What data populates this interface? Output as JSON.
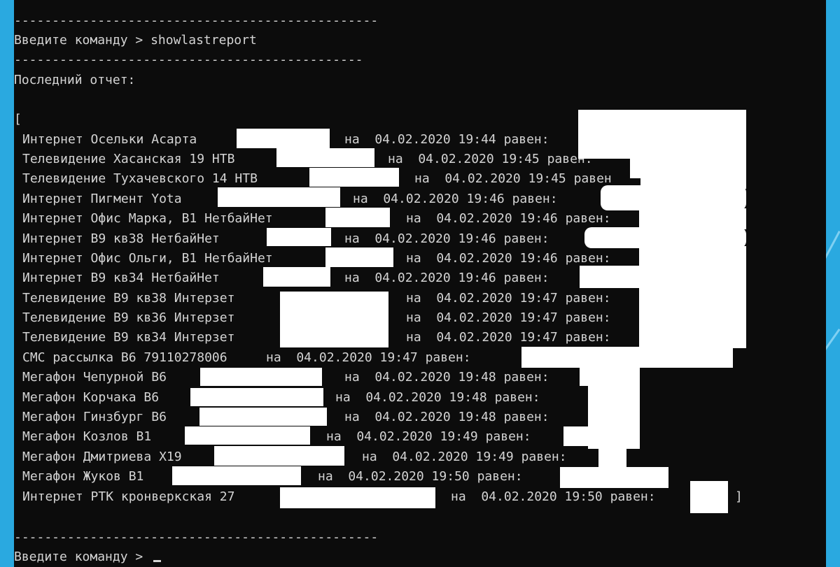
{
  "terminal": {
    "separator_long": "------------------------------------------------",
    "separator_short": "----------------------------------------------",
    "prompt": "Введите команду > ",
    "command": "showlastreport",
    "report_header": "Последний отчет:",
    "open_bracket": "[",
    "close_bracket": "]",
    "rows": [
      {
        "label": "Интернет Осельки Асарта",
        "suffix": "на  04.02.2020 19:44 равен:"
      },
      {
        "label": "Телевидение Хасанская 19 НТВ",
        "suffix": "на  04.02.2020 19:45 равен:"
      },
      {
        "label": "Телевидение Тухачевского 14 НТВ",
        "suffix": "на  04.02.2020 19:45 равен"
      },
      {
        "label": "Интернет Пигмент Yota",
        "suffix": "на  04.02.2020 19:46 равен:"
      },
      {
        "label": "Интернет Офис Марка, В1 НетбайНет",
        "suffix": "на  04.02.2020 19:46 равен:"
      },
      {
        "label": "Интернет В9 кв38 НетбайНет",
        "suffix": "на  04.02.2020 19:46 равен:"
      },
      {
        "label": "Интернет Офис Ольги, В1 НетбайНет",
        "suffix": "на  04.02.2020 19:46 равен:"
      },
      {
        "label": "Интернет В9 кв34 НетбайНет",
        "suffix": "на  04.02.2020 19:46 равен:"
      },
      {
        "label": "Телевидение В9 кв38 Интерзет",
        "suffix": "на  04.02.2020 19:47 равен:"
      },
      {
        "label": "Телевидение В9 кв36 Интерзет",
        "suffix": "на  04.02.2020 19:47 равен:"
      },
      {
        "label": "Телевидение В9 кв34 Интерзет",
        "suffix": "на  04.02.2020 19:47 равен:"
      },
      {
        "label": "СМС рассылка В6 79110278006",
        "suffix": "на  04.02.2020 19:47 равен:"
      },
      {
        "label": "Мегафон Чепурной В6",
        "suffix": "на  04.02.2020 19:48 равен:"
      },
      {
        "label": "Мегафон Корчака В6",
        "suffix": "на  04.02.2020 19:48 равен:"
      },
      {
        "label": "Мегафон Гинзбург В6",
        "suffix": "на  04.02.2020 19:48 равен:"
      },
      {
        "label": "Мегафон Козлов В1",
        "suffix": "на  04.02.2020 19:49 равен:"
      },
      {
        "label": "Мегафон Дмитриева Х19",
        "suffix": "на  04.02.2020 19:49 равен:"
      },
      {
        "label": "Мегафон Жуков В1",
        "suffix": "на  04.02.2020 19:50 равен:"
      },
      {
        "label": "Интернет РТК кронверкская 27",
        "suffix": "на  04.02.2020 19:50 равен:"
      }
    ]
  }
}
